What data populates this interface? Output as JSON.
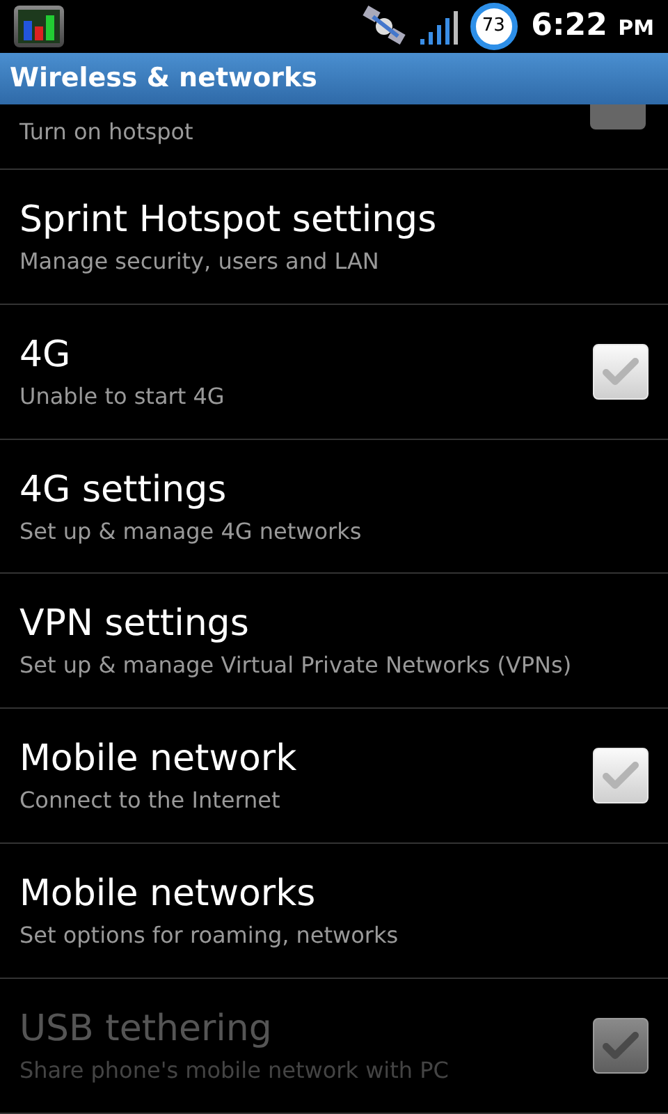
{
  "status_bar": {
    "battery": "73",
    "time": "6:22",
    "ampm": "PM"
  },
  "title": "Wireless & networks",
  "items": [
    {
      "summary": "Turn on hotspot",
      "kind": "checkbox",
      "checked": false,
      "disabled": false,
      "partial": true
    },
    {
      "title": "Sprint Hotspot settings",
      "summary": "Manage security, users and LAN",
      "kind": "link",
      "disabled": false
    },
    {
      "title": "4G",
      "summary": "Unable to start 4G",
      "kind": "checkbox",
      "checked": false,
      "disabled": false
    },
    {
      "title": "4G settings",
      "summary": "Set up & manage 4G networks",
      "kind": "link",
      "disabled": false
    },
    {
      "title": "VPN settings",
      "summary": "Set up & manage Virtual Private Networks (VPNs)",
      "kind": "link",
      "disabled": false
    },
    {
      "title": "Mobile network",
      "summary": "Connect to the Internet",
      "kind": "checkbox",
      "checked": false,
      "disabled": false
    },
    {
      "title": "Mobile networks",
      "summary": "Set options for roaming, networks",
      "kind": "link",
      "disabled": false
    },
    {
      "title": "USB tethering",
      "summary": "Share phone's mobile network with PC",
      "kind": "checkbox",
      "checked": false,
      "disabled": true
    }
  ]
}
